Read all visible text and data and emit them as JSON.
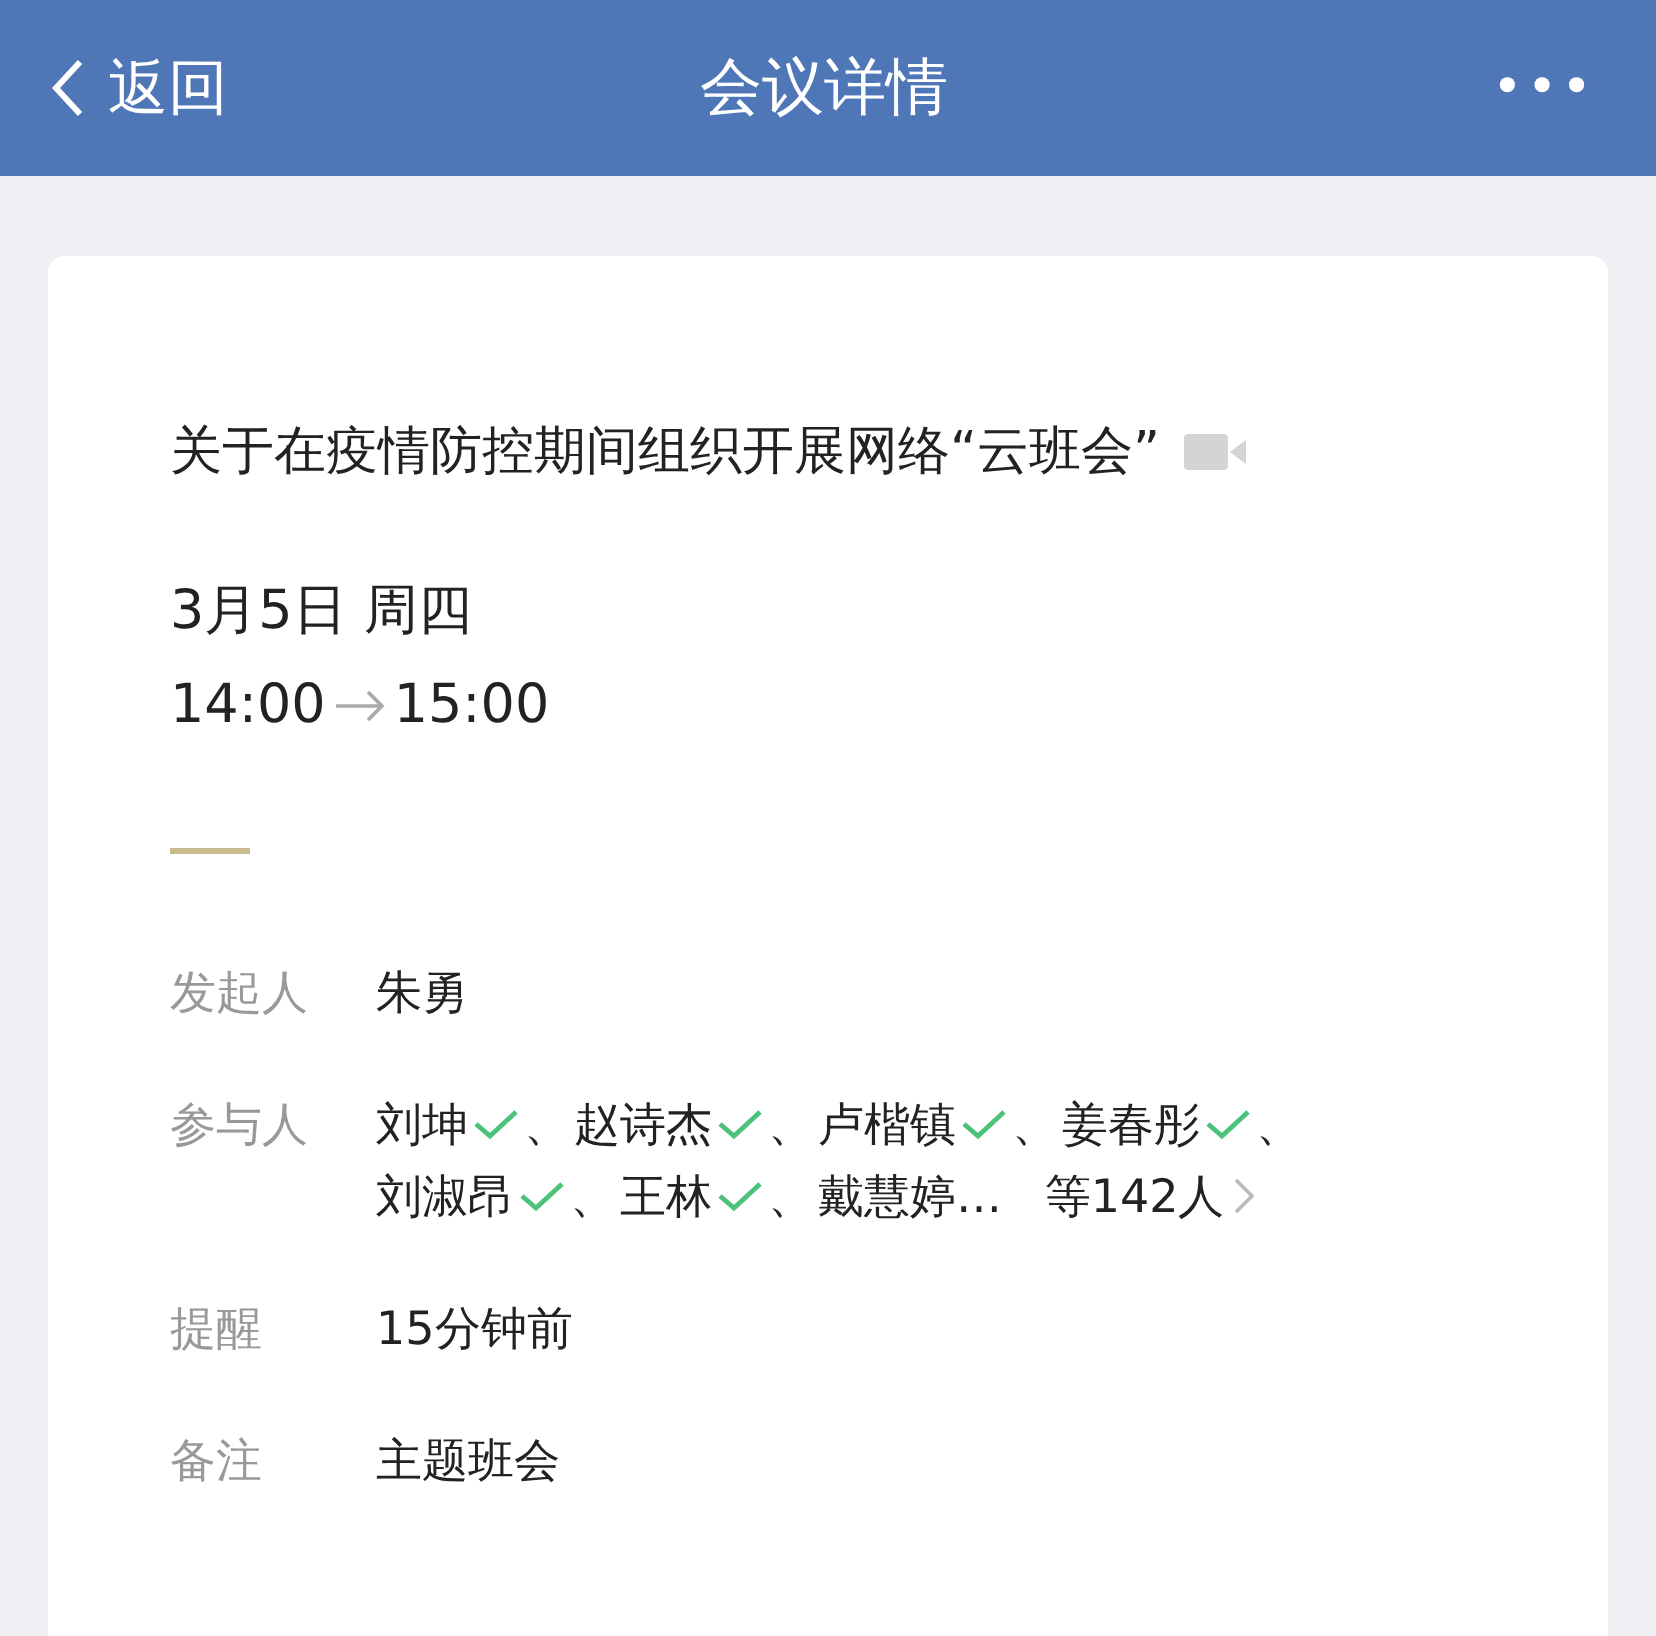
{
  "nav_bar": {
    "back": "返回",
    "title": "会议详情",
    "more": "•••"
  },
  "meeting": {
    "title": "关于在疫情防控期间组织开展网络“云班会”",
    "video": true,
    "date": "3月5日 周四",
    "start": "14:00",
    "end": "15:00"
  },
  "details": [
    {
      "kind": "text",
      "label": "发起人",
      "value": "朱勇"
    },
    {
      "kind": "people",
      "label": "参与人",
      "separator": "、",
      "people": [
        {
          "name": "刘坤",
          "accepted": true
        },
        {
          "name": "赵诗杰",
          "accepted": true
        },
        {
          "name": "卢楷镇",
          "accepted": true
        },
        {
          "name": "姜春彤",
          "accepted": true
        },
        {
          "name": "刘淑昂",
          "accepted": true
        },
        {
          "name": "王林",
          "accepted": true
        },
        {
          "name": "戴慧婷…",
          "accepted": false
        }
      ],
      "more": "等142人"
    },
    {
      "kind": "text",
      "label": "提醒",
      "value": "15分钟前"
    },
    {
      "kind": "text",
      "label": "备注",
      "value": "主题班会"
    }
  ]
}
